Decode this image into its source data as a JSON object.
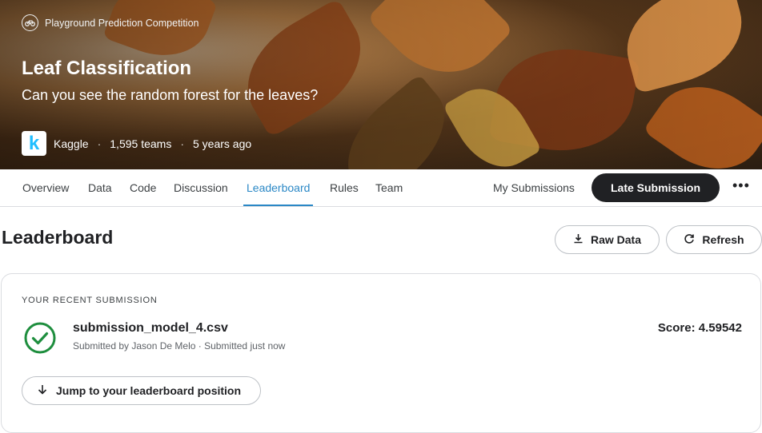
{
  "hero": {
    "competition_type": "Playground Prediction Competition",
    "title": "Leaf Classification",
    "subtitle": "Can you see the random forest for the leaves?",
    "host": "Kaggle",
    "teams": "1,595 teams",
    "age": "5 years ago",
    "separator": "·",
    "logo_letter": "k"
  },
  "tabs": [
    {
      "label": "Overview"
    },
    {
      "label": "Data"
    },
    {
      "label": "Code"
    },
    {
      "label": "Discussion"
    },
    {
      "label": "Leaderboard",
      "active": true
    },
    {
      "label": "Rules"
    },
    {
      "label": "Team"
    }
  ],
  "nav": {
    "my_submissions": "My Submissions",
    "late_submission": "Late Submission",
    "more": "•••"
  },
  "leaderboard": {
    "title": "Leaderboard",
    "raw_data": "Raw Data",
    "refresh": "Refresh"
  },
  "recent_submission": {
    "heading": "YOUR RECENT SUBMISSION",
    "filename": "submission_model_4.csv",
    "meta": "Submitted by Jason De Melo · Submitted just now",
    "score": "Score: 4.59542",
    "jump_label": "Jump to your leaderboard position"
  },
  "colors": {
    "accent": "#2b88c6",
    "success": "#1e8e3e",
    "dark_button": "#202124"
  }
}
